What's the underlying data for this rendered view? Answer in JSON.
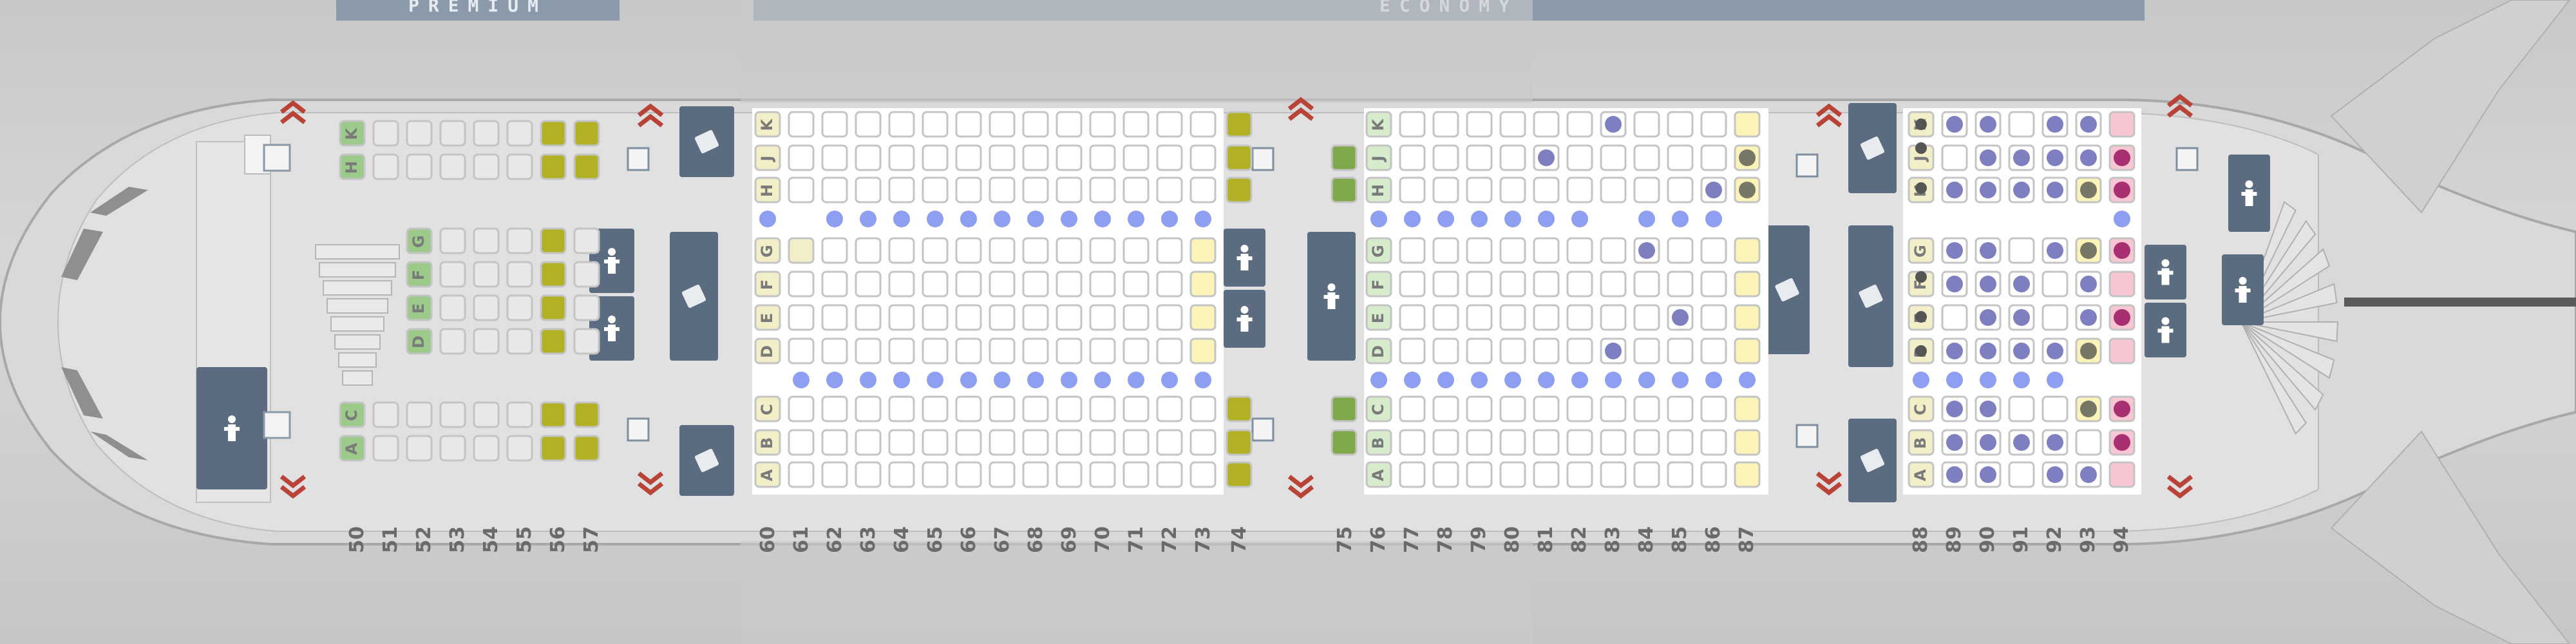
{
  "cabins": {
    "premium_label": "PREMIUM",
    "economy_label": "ECONOMY"
  },
  "rows": [
    "50",
    "51",
    "52",
    "53",
    "54",
    "55",
    "56",
    "57",
    "60",
    "61",
    "62",
    "63",
    "64",
    "65",
    "66",
    "67",
    "68",
    "69",
    "70",
    "71",
    "72",
    "73",
    "74",
    "75",
    "76",
    "77",
    "78",
    "79",
    "80",
    "81",
    "82",
    "83",
    "84",
    "85",
    "86",
    "87",
    "88",
    "89",
    "90",
    "91",
    "92",
    "93",
    "94"
  ],
  "seat_letters": {
    "premium_upper": [
      "H",
      "K"
    ],
    "premium_middle": [
      "D",
      "E",
      "F",
      "G"
    ],
    "premium_lower": [
      "A",
      "C"
    ],
    "economy_upper": [
      "H",
      "J",
      "K"
    ],
    "economy_middle": [
      "D",
      "E",
      "F",
      "G"
    ],
    "economy_lower": [
      "A",
      "B",
      "C"
    ]
  },
  "legend_colors": {
    "available": "#ffffff",
    "extra_legroom": "#fbf3b8",
    "premium_seat": "#b2b024",
    "occupied_dot": "#7d7fc0",
    "preferred_dot": "#a83070",
    "preferred_bg": "#f7c6d2",
    "aisle_dot": "#8e9ef0",
    "exit_marker": "#b84438",
    "facility": "#5b6c80"
  },
  "icons": [
    "exit-chevron-icon",
    "lavatory-icon",
    "galley-icon",
    "closet-icon",
    "bassinet-icon"
  ]
}
